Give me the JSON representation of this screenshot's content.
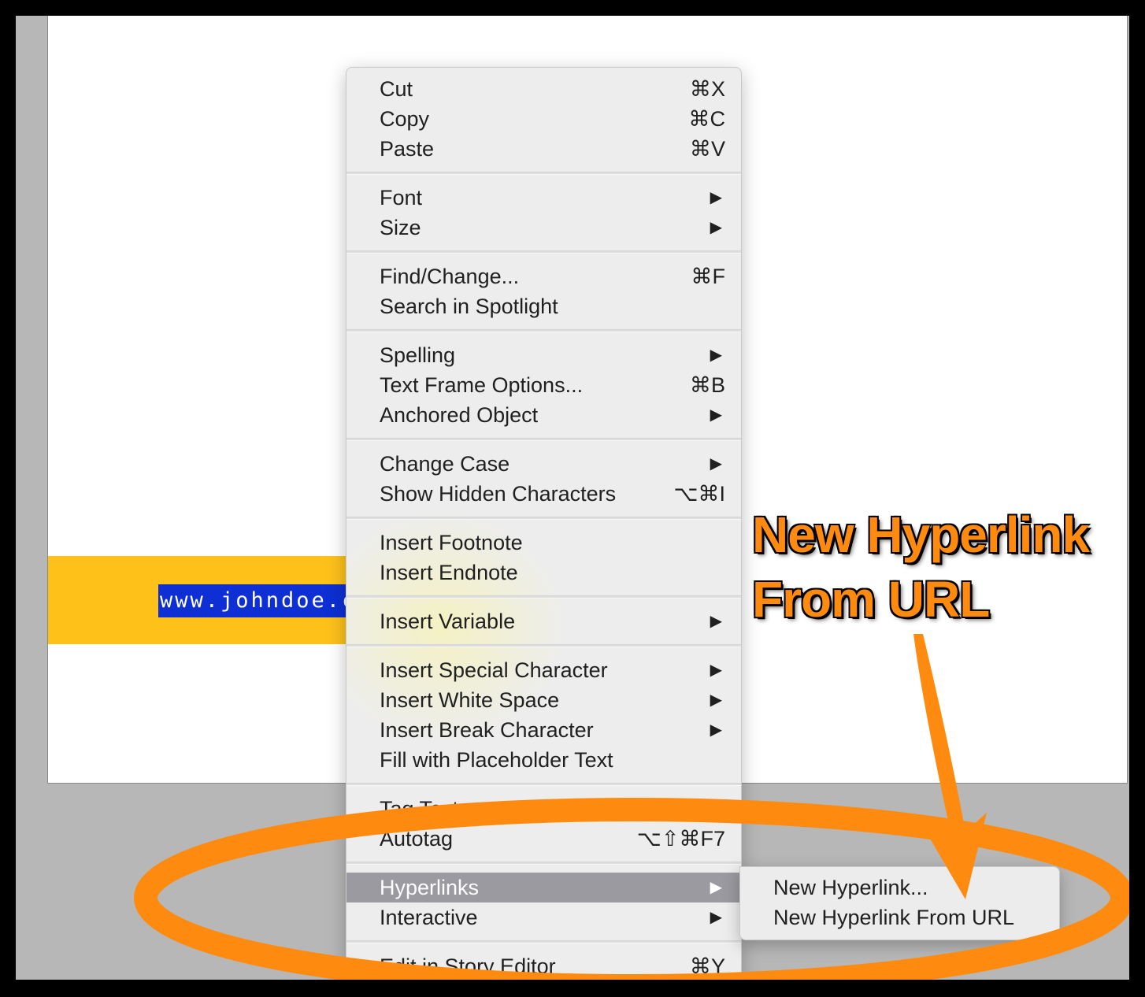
{
  "document": {
    "selected_text": "www.johndoe.c"
  },
  "context_menu": {
    "groups": [
      [
        {
          "label": "Cut",
          "shortcut": "⌘X"
        },
        {
          "label": "Copy",
          "shortcut": "⌘C"
        },
        {
          "label": "Paste",
          "shortcut": "⌘V"
        }
      ],
      [
        {
          "label": "Font",
          "submenu": "▶"
        },
        {
          "label": "Size",
          "submenu": "▶"
        }
      ],
      [
        {
          "label": "Find/Change...",
          "shortcut": "⌘F"
        },
        {
          "label": "Search in Spotlight"
        }
      ],
      [
        {
          "label": "Spelling",
          "submenu": "▶"
        },
        {
          "label": "Text Frame Options...",
          "shortcut": "⌘B"
        },
        {
          "label": "Anchored Object",
          "submenu": "▶"
        }
      ],
      [
        {
          "label": "Change Case",
          "submenu": "▶"
        },
        {
          "label": "Show Hidden Characters",
          "shortcut": "⌥⌘I"
        }
      ],
      [
        {
          "label": "Insert Footnote"
        },
        {
          "label": "Insert Endnote"
        }
      ],
      [
        {
          "label": "Insert Variable",
          "submenu": "▶"
        }
      ],
      [
        {
          "label": "Insert Special Character",
          "submenu": "▶"
        },
        {
          "label": "Insert White Space",
          "submenu": "▶"
        },
        {
          "label": "Insert Break Character",
          "submenu": "▶"
        },
        {
          "label": "Fill with Placeholder Text"
        }
      ],
      [
        {
          "label": "Tag Text",
          "submenu": "▶"
        },
        {
          "label": "Autotag",
          "shortcut": "⌥⇧⌘F7"
        }
      ],
      [
        {
          "label": "Hyperlinks",
          "submenu": "▶",
          "highlighted": true
        },
        {
          "label": "Interactive",
          "submenu": "▶"
        }
      ],
      [
        {
          "label": "Edit in Story Editor",
          "shortcut": "⌘Y"
        }
      ]
    ]
  },
  "hyperlinks_submenu": {
    "items": [
      {
        "label": "New Hyperlink..."
      },
      {
        "label": "New Hyperlink From URL"
      }
    ]
  },
  "annotation": {
    "line1": "New Hyperlink",
    "line2": "From URL",
    "color": "#ff8a10"
  }
}
